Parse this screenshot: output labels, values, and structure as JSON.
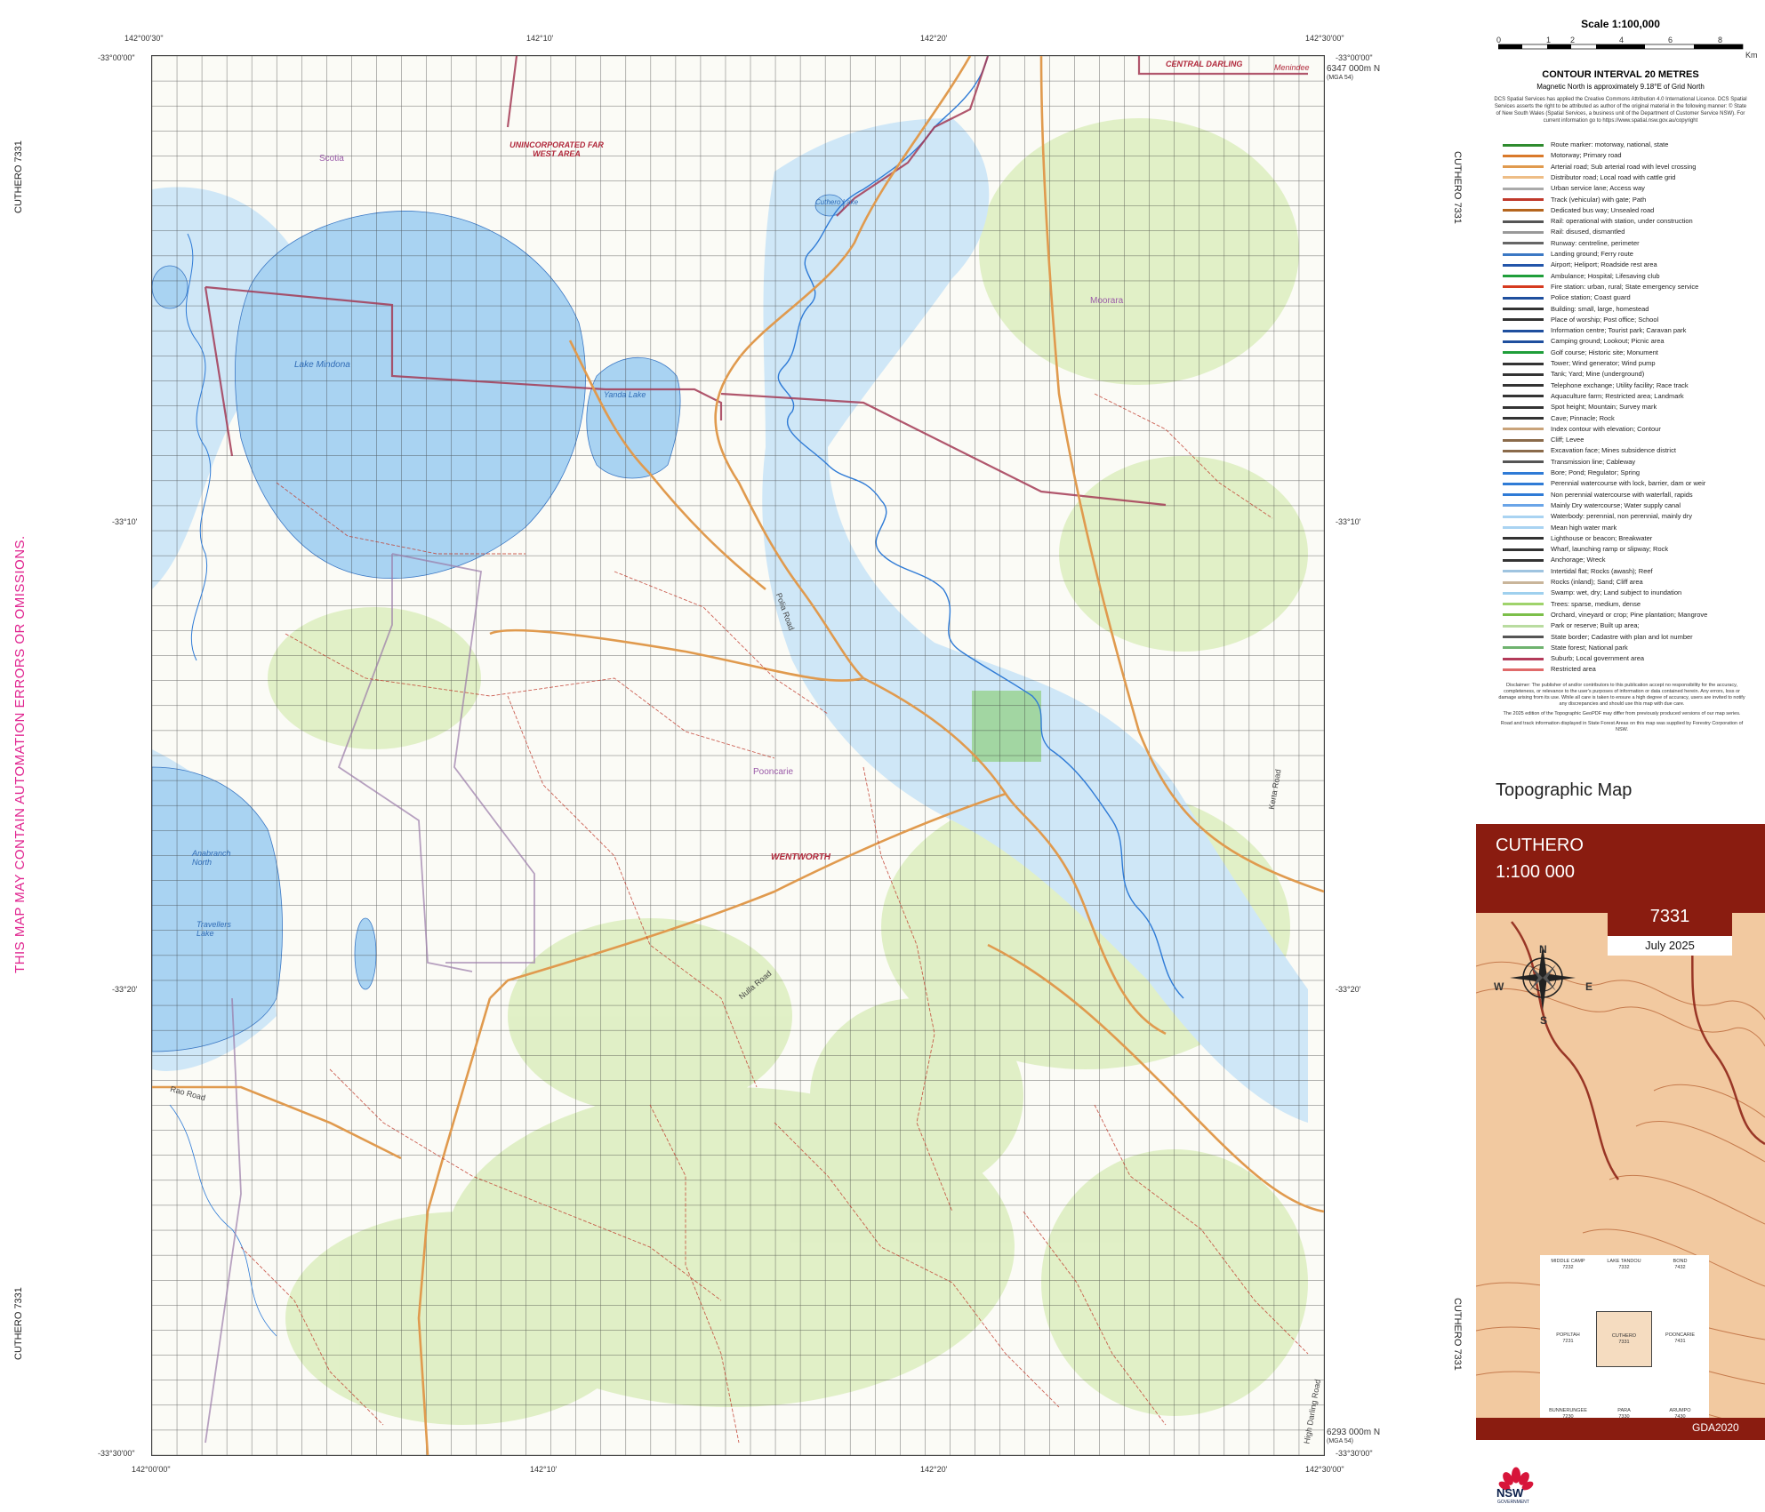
{
  "sheet": {
    "side_title": "CUTHERO 7331",
    "warning": "THIS MAP MAY CONTAIN AUTOMATION ERRORS OR OMISSIONS."
  },
  "frame_labels": {
    "top_left_lon": "142°00'30\"",
    "top_mid1_lon": "142°10'",
    "top_mid2_lon": "142°20'",
    "top_right_lon": "142°30'00\"",
    "top_left_lat": "-33°00'00\"",
    "top_right_lat": "-33°00'00\"",
    "lat_10": "-33°10'",
    "lat_20": "-33°20'",
    "bottom_left_lat": "-33°30'00\"",
    "bottom_right_lat": "-33°30'00\"",
    "bottom_left_lon": "142°00'00\"",
    "bottom_mid1_lon": "142°10'",
    "bottom_mid2_lon": "142°20'",
    "bottom_right_lon": "142°30'00\"",
    "northing_top": "6347 000m N",
    "northing_bottom": "6293 000m N",
    "mga": "(MGA 54)"
  },
  "map_labels": [
    {
      "text": "Lake Mindona",
      "kind": "water"
    },
    {
      "text": "Yanda Lake",
      "kind": "water"
    },
    {
      "text": "Cuthero Lake",
      "kind": "water"
    },
    {
      "text": "Anabranch North",
      "kind": "water"
    },
    {
      "text": "Travellers Lake",
      "kind": "water"
    },
    {
      "text": "UNINCORPORATED FAR WEST AREA",
      "kind": "admin"
    },
    {
      "text": "CENTRAL DARLING",
      "kind": "admin"
    },
    {
      "text": "Menindee",
      "kind": "admin"
    },
    {
      "text": "WENTWORTH",
      "kind": "admin"
    },
    {
      "text": "Pooncarie",
      "kind": "locality"
    },
    {
      "text": "Moorara",
      "kind": "locality"
    },
    {
      "text": "Scotia",
      "kind": "locality"
    },
    {
      "text": "Nulla Road",
      "kind": "road"
    },
    {
      "text": "Polia Road",
      "kind": "road"
    },
    {
      "text": "Rao Road",
      "kind": "road"
    },
    {
      "text": "Kerta Road",
      "kind": "road"
    },
    {
      "text": "High Darling Road",
      "kind": "road"
    }
  ],
  "legend": {
    "scale_title": "Scale 1:100,000",
    "scale_ticks": [
      "0",
      "1",
      "2",
      "4",
      "6",
      "8"
    ],
    "scale_unit": "Km",
    "contour_title": "CONTOUR INTERVAL 20 METRES",
    "magnetic": "Magnetic North is approximately 9.18°E of Grid North",
    "licence": "DCS Spatial Services has applied the Creative Commons Attribution 4.0 International Licence. DCS Spatial Services asserts the right to be attributed as author of the original material in the following manner: © State of New South Wales (Spatial Services, a business unit of the Department of Customer Service NSW). For current information go to https://www.spatial.nsw.gov.au/copyright",
    "items": [
      {
        "label": "Route marker: motorway, national, state",
        "color": "#2e8b2e"
      },
      {
        "label": "Motorway; Primary road",
        "color": "#d9792a"
      },
      {
        "label": "Arterial road; Sub arterial road with level crossing",
        "color": "#e09a4e"
      },
      {
        "label": "Distributor road; Local road with cattle grid",
        "color": "#eebd86"
      },
      {
        "label": "Urban service lane; Access way",
        "color": "#aaaaaa"
      },
      {
        "label": "Track (vehicular) with gate; Path",
        "color": "#c0392b"
      },
      {
        "label": "Dedicated bus way; Unsealed road",
        "color": "#b5651d"
      },
      {
        "label": "Rail: operational with station, under construction",
        "color": "#555555"
      },
      {
        "label": "Rail: disused, dismantled",
        "color": "#999999"
      },
      {
        "label": "Runway: centreline, perimeter",
        "color": "#666666"
      },
      {
        "label": "Landing ground; Ferry route",
        "color": "#3b78c4"
      },
      {
        "label": "Airport; Heliport; Roadside rest area",
        "color": "#2255aa"
      },
      {
        "label": "Ambulance; Hospital; Lifesaving club",
        "color": "#1f9e3a"
      },
      {
        "label": "Fire station: urban, rural; State emergency service",
        "color": "#d63a1f"
      },
      {
        "label": "Police station; Coast guard",
        "color": "#1f4f9e"
      },
      {
        "label": "Building: small, large, homestead",
        "color": "#333333"
      },
      {
        "label": "Place of worship; Post office; School",
        "color": "#333333"
      },
      {
        "label": "Information centre; Tourist park; Caravan park",
        "color": "#1f4f9e"
      },
      {
        "label": "Camping ground; Lookout; Picnic area",
        "color": "#1f4f9e"
      },
      {
        "label": "Golf course; Historic site; Monument",
        "color": "#1f9e3a"
      },
      {
        "label": "Tower; Wind generator; Wind pump",
        "color": "#333333"
      },
      {
        "label": "Tank; Yard; Mine (underground)",
        "color": "#333333"
      },
      {
        "label": "Telephone exchange; Utility facility; Race track",
        "color": "#333333"
      },
      {
        "label": "Aquaculture farm; Restricted area; Landmark",
        "color": "#333333"
      },
      {
        "label": "Spot height; Mountain; Survey mark",
        "color": "#333333"
      },
      {
        "label": "Cave; Pinnacle; Rock",
        "color": "#333333"
      },
      {
        "label": "Index contour with elevation; Contour",
        "color": "#c9a37a"
      },
      {
        "label": "Cliff; Levee",
        "color": "#8a6a4a"
      },
      {
        "label": "Excavation face; Mines subsidence district",
        "color": "#8a6a4a"
      },
      {
        "label": "Transmission line; Cableway",
        "color": "#555555"
      },
      {
        "label": "Bore; Pond; Regulator; Spring",
        "color": "#2f7bd6"
      },
      {
        "label": "Perennial watercourse with lock, barrier, dam or weir",
        "color": "#2f7bd6"
      },
      {
        "label": "Non perennial watercourse with waterfall, rapids",
        "color": "#2f7bd6"
      },
      {
        "label": "Mainly Dry watercourse; Water supply canal",
        "color": "#6aa5e8"
      },
      {
        "label": "Waterbody: perennial, non perennial, mainly dry",
        "color": "#a9d3f2"
      },
      {
        "label": "Mean high water mark",
        "color": "#a9d3f2"
      },
      {
        "label": "Lighthouse or beacon; Breakwater",
        "color": "#333333"
      },
      {
        "label": "Wharf, launching ramp or slipway; Rock",
        "color": "#333333"
      },
      {
        "label": "Anchorage; Wreck",
        "color": "#333333"
      },
      {
        "label": "Intertidal flat; Rocks (awash); Reef",
        "color": "#9fc4e0"
      },
      {
        "label": "Rocks (inland); Sand; Cliff area",
        "color": "#c9b59a"
      },
      {
        "label": "Swamp: wet, dry; Land subject to inundation",
        "color": "#9fd0ee"
      },
      {
        "label": "Trees: sparse, medium, dense",
        "color": "#9fd36b"
      },
      {
        "label": "Orchard, vineyard or crop; Pine plantation; Mangrove",
        "color": "#7cbf4a"
      },
      {
        "label": "Park or reserve; Built up area;",
        "color": "#b9dca0"
      },
      {
        "label": "State border; Cadastre with plan and lot number",
        "color": "#555555"
      },
      {
        "label": "State forest; National park",
        "color": "#6fb36f"
      },
      {
        "label": "Suburb; Local government area",
        "color": "#b33a5a"
      },
      {
        "label": "Restricted area",
        "color": "#e06a6a"
      }
    ],
    "disclaimer": "Disclaimer: The publisher of and/or contributors to this publication accept no responsibility for the accuracy, completeness, or relevance to the user's purposes of information or data contained herein. Any errors, loss or damage arising from its use. While all care is taken to ensure a high degree of accuracy, users are invited to notify any discrepancies and should use this map with due care.",
    "disclaimer2": "The 2025 edition of the Topographic GeoPDF may differ from previously produced versions of our map series.",
    "disclaimer3": "Road and track information displayed in State Forest Areas on this map was supplied by Forestry Corporation of NSW."
  },
  "cover": {
    "topo_title": "Topographic Map",
    "name": "CUTHERO",
    "scale": "1:100 000",
    "sheet_number": "7331",
    "date": "July 2025",
    "datum": "GDA2020",
    "compass": {
      "n": "N",
      "s": "S",
      "e": "E",
      "w": "W"
    },
    "index": [
      {
        "name": "MIDDLE CAMP",
        "num": "7232"
      },
      {
        "name": "LAKE TANDOU",
        "num": "7332"
      },
      {
        "name": "BOND",
        "num": "7432"
      },
      {
        "name": "POPILTAH",
        "num": "7231"
      },
      {
        "name": "CUTHERO",
        "num": "7331"
      },
      {
        "name": "POONCARIE",
        "num": "7431"
      },
      {
        "name": "BUNNERUNGEE",
        "num": "7230"
      },
      {
        "name": "PARA",
        "num": "7330"
      },
      {
        "name": "ARUMPO",
        "num": "7430"
      }
    ],
    "nsw": "NSW",
    "nsw_sub": "GOVERNMENT"
  },
  "colors": {
    "water": "#a9d3f2",
    "swamp": "#cfe7f7",
    "veg": "#d8ecb7",
    "road_main": "#e09a4e",
    "track": "#c0392b",
    "boundary": "#a33a55",
    "grid": "#333333",
    "cover_red": "#8a1c10"
  }
}
